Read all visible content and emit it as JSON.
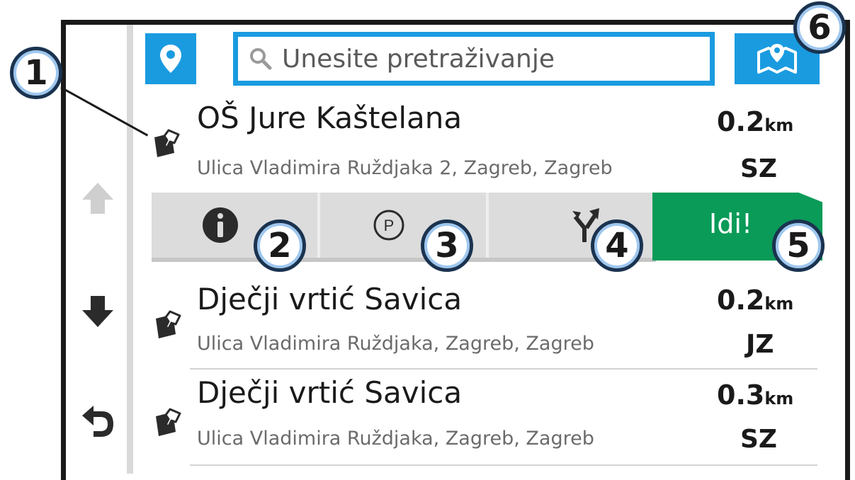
{
  "search": {
    "placeholder": "Unesite pretraživanje"
  },
  "icons": {
    "location": "map-pin-icon",
    "search": "magnifier-icon",
    "map": "folded-map-icon",
    "up": "arrow-up-icon",
    "down": "arrow-down-icon",
    "back": "back-icon",
    "poi": "poi-category-icon",
    "info": "info-icon",
    "parking": "parking-icon",
    "route": "fork-route-icon"
  },
  "results": [
    {
      "name": "OŠ Jure Kaštelana",
      "address": "Ulica Vladimira Ruždjaka 2, Zagreb, Zagreb",
      "distance": "0.2",
      "unit": "km",
      "direction": "SZ"
    },
    {
      "name": "Dječji vrtić Savica",
      "address": "Ulica Vladimira Ruždjaka, Zagreb, Zagreb",
      "distance": "0.2",
      "unit": "km",
      "direction": "JZ"
    },
    {
      "name": "Dječji vrtić Savica",
      "address": "Ulica Vladimira Ruždjaka, Zagreb, Zagreb",
      "distance": "0.3",
      "unit": "km",
      "direction": "SZ"
    }
  ],
  "go_button": {
    "label": "Idi!"
  },
  "callouts": [
    "1",
    "2",
    "3",
    "4",
    "5",
    "6"
  ],
  "colors": {
    "accent": "#1a9be0",
    "go": "#0a9b58"
  }
}
